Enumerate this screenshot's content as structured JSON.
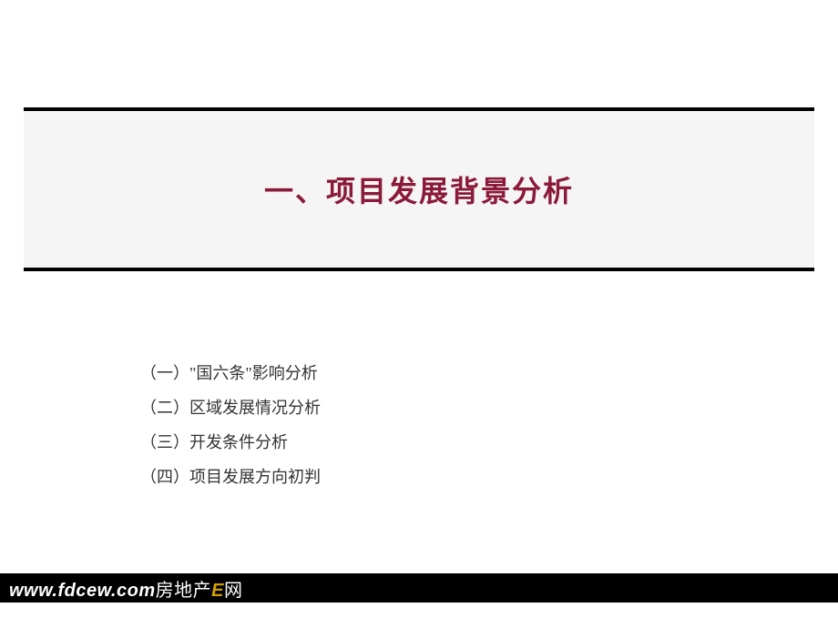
{
  "title": "一、项目发展背景分析",
  "list": {
    "items": [
      "（一）\"国六条\"影响分析",
      "（二）区域发展情况分析",
      "（三）开发条件分析",
      "（四）项目发展方向初判"
    ]
  },
  "footer": {
    "url": "www.fdcew.com",
    "label_part1": "房地产",
    "label_highlight": "E",
    "label_part2": "网"
  }
}
